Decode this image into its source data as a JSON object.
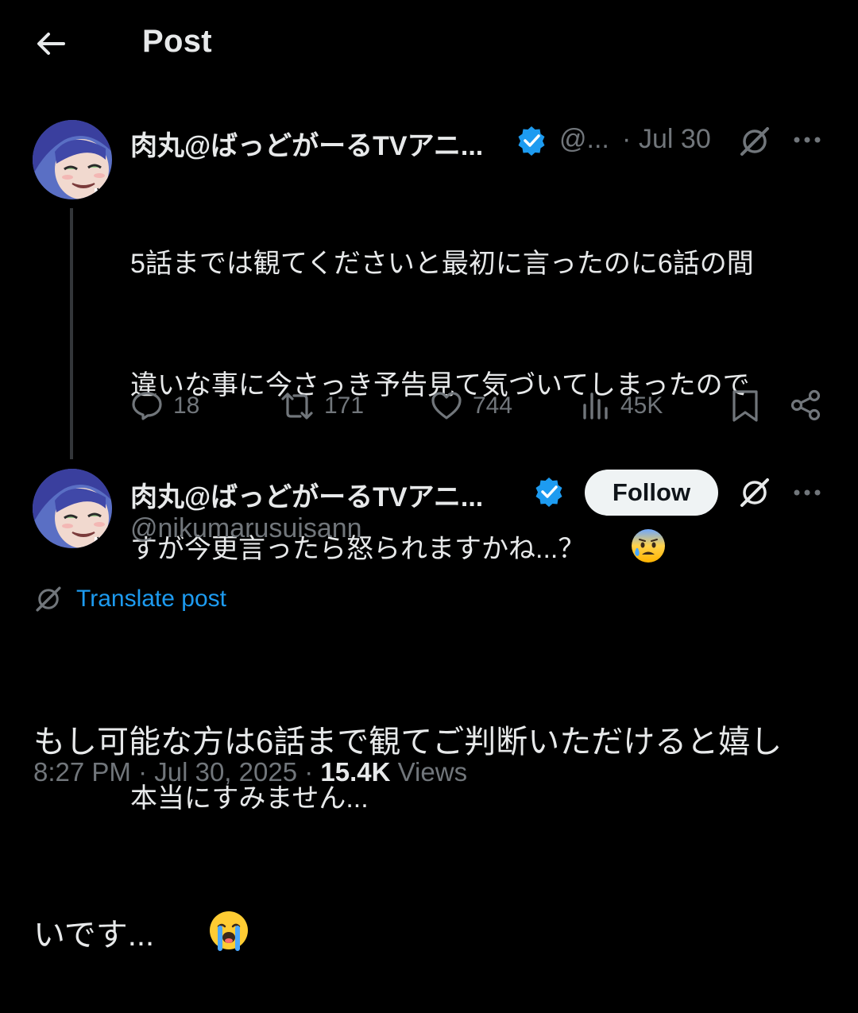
{
  "header": {
    "title": "Post",
    "back_icon": "arrow-left-icon"
  },
  "parent_post": {
    "display_name": "肉丸@ばっどがーるTVアニ...",
    "handle": "@...",
    "separator": "·",
    "date": "Jul 30",
    "text_lines": [
      "5話までは観てくださいと最初に言ったのに6話の間",
      "違いな事に今さっき予告見て気づいてしまったので",
      "すが今更言ったら怒られますかね...？"
    ],
    "text_line_last": "本当にすみません...",
    "emoji": "anxious-face-with-sweat",
    "stats": {
      "replies": "18",
      "reposts": "171",
      "likes": "744",
      "views": "45K"
    }
  },
  "main_post": {
    "display_name": "肉丸@ばっどがーるTVアニ...",
    "handle": "@nikumarusuisann",
    "follow_label": "Follow",
    "translate_label": "Translate post",
    "text_line1": "もし可能な方は6話まで観てご判断いただけると嬉し",
    "text_line2": "いです...",
    "emoji": "loudly-crying-face",
    "time": "8:27 PM",
    "date": "Jul 30, 2025",
    "dot": "·",
    "views_count": "15.4K",
    "views_label": "Views"
  },
  "colors": {
    "accent": "#1d9bf0",
    "background": "#000000",
    "text": "#e7e9ea",
    "muted": "#71767b",
    "follow_bg": "#eff3f4"
  }
}
